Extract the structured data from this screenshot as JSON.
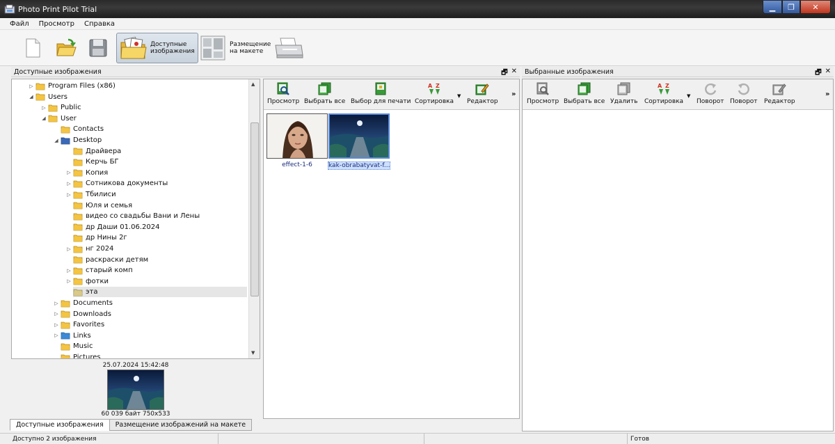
{
  "window": {
    "title": "Photo Print Pilot Trial"
  },
  "menu": [
    "Файл",
    "Просмотр",
    "Справка"
  ],
  "toolbar": {
    "available_label": "Доступные\nизображения",
    "layout_label": "Размещение\nна макете"
  },
  "left_panel": {
    "title": "Доступные изображения",
    "tree": [
      {
        "label": "Program Files (x86)",
        "level": 1,
        "expander": "collapsed",
        "icon": "folder-icon"
      },
      {
        "label": "Users",
        "level": 1,
        "expander": "expanded",
        "icon": "folder-icon"
      },
      {
        "label": "Public",
        "level": 2,
        "expander": "collapsed",
        "icon": "folder-icon"
      },
      {
        "label": "User",
        "level": 2,
        "expander": "expanded",
        "icon": "user-folder-icon"
      },
      {
        "label": "Contacts",
        "level": 3,
        "expander": "none",
        "icon": "contacts-folder-icon"
      },
      {
        "label": "Desktop",
        "level": 3,
        "expander": "expanded",
        "icon": "desktop-folder-icon"
      },
      {
        "label": "Драйвера",
        "level": 4,
        "expander": "none",
        "icon": "folder-icon"
      },
      {
        "label": "Керчь БГ",
        "level": 4,
        "expander": "none",
        "icon": "folder-icon"
      },
      {
        "label": "Копия",
        "level": 4,
        "expander": "collapsed",
        "icon": "folder-icon"
      },
      {
        "label": "Сотникова документы",
        "level": 4,
        "expander": "collapsed",
        "icon": "folder-icon"
      },
      {
        "label": "Тбилиси",
        "level": 4,
        "expander": "collapsed",
        "icon": "folder-icon"
      },
      {
        "label": "Юля и семья",
        "level": 4,
        "expander": "none",
        "icon": "folder-icon"
      },
      {
        "label": "видео со свадьбы Вани и Лены",
        "level": 4,
        "expander": "none",
        "icon": "folder-icon"
      },
      {
        "label": "др Даши 01.06.2024",
        "level": 4,
        "expander": "none",
        "icon": "folder-icon"
      },
      {
        "label": "др Нины 2г",
        "level": 4,
        "expander": "none",
        "icon": "folder-icon"
      },
      {
        "label": "нг 2024",
        "level": 4,
        "expander": "collapsed",
        "icon": "folder-icon"
      },
      {
        "label": "раскраски детям",
        "level": 4,
        "expander": "none",
        "icon": "folder-icon"
      },
      {
        "label": "старый комп",
        "level": 4,
        "expander": "collapsed",
        "icon": "folder-icon"
      },
      {
        "label": "фотки",
        "level": 4,
        "expander": "collapsed",
        "icon": "folder-icon"
      },
      {
        "label": "эта",
        "level": 4,
        "expander": "none",
        "icon": "folder-open-icon",
        "selected": true
      },
      {
        "label": "Documents",
        "level": 3,
        "expander": "collapsed",
        "icon": "documents-folder-icon"
      },
      {
        "label": "Downloads",
        "level": 3,
        "expander": "collapsed",
        "icon": "downloads-folder-icon"
      },
      {
        "label": "Favorites",
        "level": 3,
        "expander": "collapsed",
        "icon": "favorites-folder-icon"
      },
      {
        "label": "Links",
        "level": 3,
        "expander": "collapsed",
        "icon": "links-folder-icon"
      },
      {
        "label": "Music",
        "level": 3,
        "expander": "none",
        "icon": "music-folder-icon"
      },
      {
        "label": "Pictures",
        "level": 3,
        "expander": "none",
        "icon": "pictures-folder-icon"
      }
    ],
    "preview": {
      "date": "25.07.2024 15:42:48",
      "info": "60 039 байт 750x533"
    }
  },
  "available_images": {
    "toolbar": {
      "view": "Просмотр",
      "select_all": "Выбрать все",
      "select_for_print": "Выбор для печати",
      "sort": "Сортировка",
      "editor": "Редактор",
      "more": "»"
    },
    "images": [
      {
        "caption": "effect-1-6",
        "kind": "portrait",
        "selected": false
      },
      {
        "caption": "kak-obrabatyvat-f...",
        "kind": "landscape",
        "selected": true
      }
    ]
  },
  "selected_panel": {
    "title": "Выбранные изображения",
    "toolbar": {
      "view": "Просмотр",
      "select_all": "Выбрать все",
      "delete": "Удалить",
      "sort": "Сортировка",
      "rotate_left": "Поворот",
      "rotate_right": "Поворот",
      "editor": "Редактор",
      "more": "»"
    }
  },
  "tabs": [
    "Доступные изображения",
    "Размещение изображений на макете"
  ],
  "status": {
    "count": "Доступно 2 изображения",
    "state": "Готов"
  },
  "colors": {
    "selection_border": "#5a8ad8",
    "caption_text": "#1a2a7a",
    "folder_yellow": "#f3c443"
  }
}
